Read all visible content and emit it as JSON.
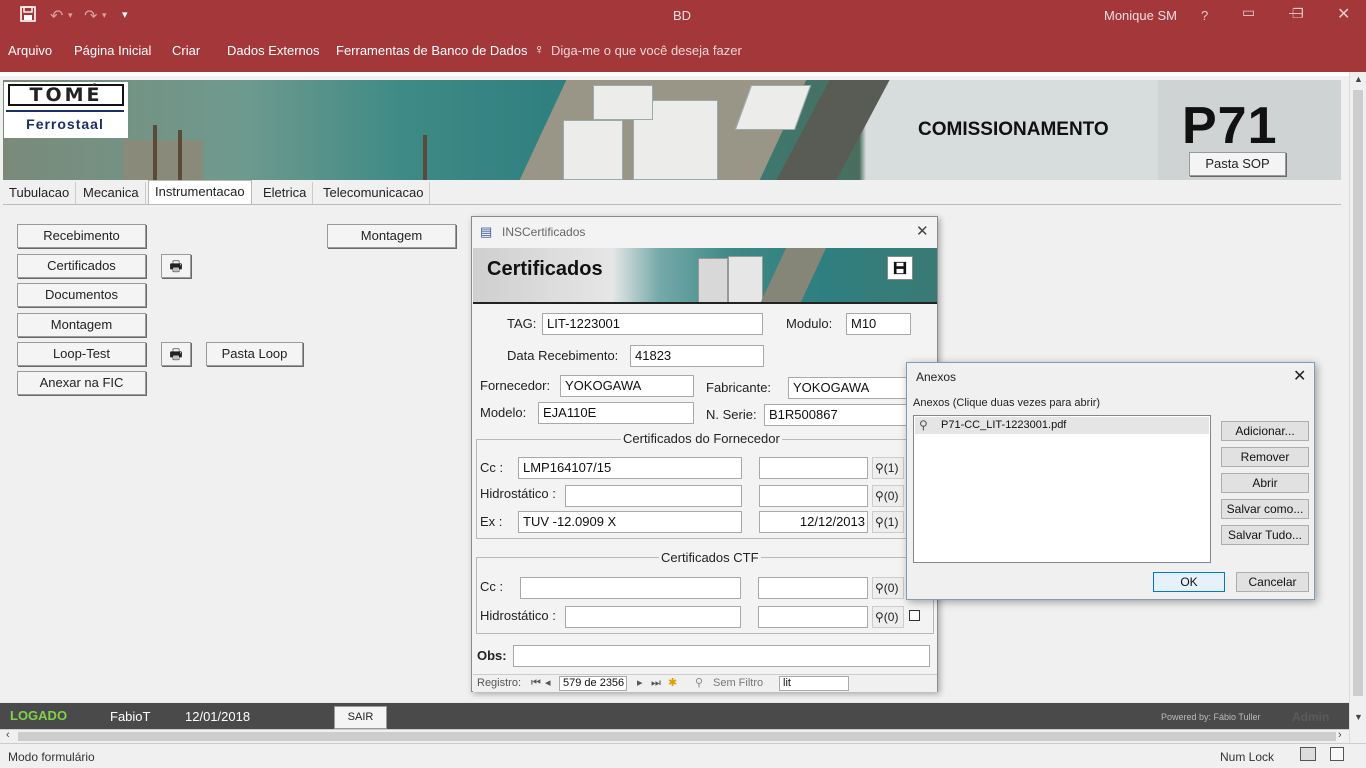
{
  "titlebar": {
    "title": "BD",
    "user": "Monique SM",
    "help": "?",
    "quick_access_arrow": "▾"
  },
  "ribbon": {
    "menu": [
      "Arquivo",
      "Página Inicial",
      "Criar",
      "Dados Externos",
      "Ferramentas de Banco de Dados"
    ],
    "tell_me": "Diga-me o que você deseja fazer"
  },
  "header": {
    "logo_top": "TOMÉ",
    "logo_bottom": "Ferrostaal",
    "section_title": "COMISSIONAMENTO",
    "project": "P71",
    "pasta_sop": "Pasta SOP"
  },
  "tabs": [
    "Tubulacao",
    "Mecanica",
    "Instrumentacao",
    "Eletrica",
    "Telecomunicacao"
  ],
  "active_tab": "Instrumentacao",
  "left_buttons": {
    "recebimento": "Recebimento",
    "certificados": "Certificados",
    "documentos": "Documentos",
    "montagem": "Montagem",
    "loop_test": "Loop-Test",
    "anexar_fic": "Anexar na FIC",
    "pasta_loop": "Pasta Loop",
    "montagem_right": "Montagem"
  },
  "form": {
    "window_title": "INSCertificados",
    "header_title": "Certificados",
    "tag_label": "TAG:",
    "tag_value": "LIT-1223001",
    "modulo_label": "Modulo:",
    "modulo_value": "M10",
    "data_label": "Data Recebimento:",
    "data_value": "41823",
    "fornecedor_label": "Fornecedor:",
    "fornecedor_value": "YOKOGAWA",
    "fabricante_label": "Fabricante:",
    "fabricante_value": "YOKOGAWA",
    "modelo_label": "Modelo:",
    "modelo_value": "EJA110E",
    "nserie_label": "N. Serie:",
    "nserie_value": "B1R500867",
    "fornecedor_section": {
      "legend": "Certificados do Fornecedor",
      "rows": [
        {
          "label": "Cc :",
          "value": "LMP164107/15",
          "date": "",
          "attach": "(1)"
        },
        {
          "label": "Hidrostático :",
          "value": "",
          "date": "",
          "attach": "(0)"
        },
        {
          "label": "Ex :",
          "value": "TUV -12.0909 X",
          "date": "12/12/2013",
          "attach": "(1)"
        }
      ]
    },
    "ctf_section": {
      "legend": "Certificados CTF",
      "rows": [
        {
          "label": "Cc :",
          "value": "",
          "date": "",
          "attach": "(0)"
        },
        {
          "label": "Hidrostático :",
          "value": "",
          "date": "",
          "attach": "(0)"
        }
      ]
    },
    "obs_label": "Obs:",
    "nav": {
      "label": "Registro:",
      "position": "579 de 2356",
      "filter": "Sem Filtro",
      "search": "lit"
    }
  },
  "dialog": {
    "title": "Anexos",
    "subtitle": "Anexos (Clique duas vezes para abrir)",
    "files": [
      "P71-CC_LIT-1223001.pdf"
    ],
    "buttons": [
      "Adicionar...",
      "Remover",
      "Abrir",
      "Salvar como...",
      "Salvar Tudo..."
    ],
    "ok": "OK",
    "cancel": "Cancelar"
  },
  "app_status": {
    "logged": "LOGADO",
    "user": "FabioT",
    "date": "12/01/2018",
    "exit": "SAIR",
    "powered": "Powered by: Fábio Tuller",
    "admin": "Admin"
  },
  "statusbar": {
    "mode": "Modo formulário",
    "numlock": "Num Lock"
  },
  "colors": {
    "ribbon": "#a4373a",
    "logged": "#7fd34a",
    "status_bg": "#4a4a4a"
  }
}
